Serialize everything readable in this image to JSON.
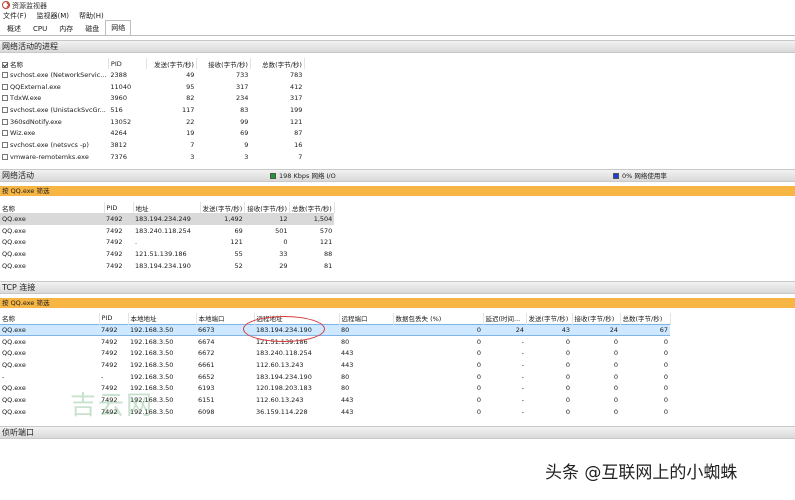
{
  "window": {
    "title": "资源监视器"
  },
  "menu": [
    "文件(F)",
    "监视器(M)",
    "帮助(H)"
  ],
  "tabs": [
    "概述",
    "CPU",
    "内存",
    "磁盘",
    "网络"
  ],
  "active_tab": "网络",
  "processes_section": {
    "title": "网络活动的进程",
    "headers": [
      "名称",
      "PID",
      "发送(字节/秒)",
      "接收(字节/秒)",
      "总数(字节/秒)"
    ],
    "rows": [
      [
        "svchost.exe (NetworkServic...",
        "2388",
        "49",
        "733",
        "783"
      ],
      [
        "QQExternal.exe",
        "11040",
        "95",
        "317",
        "412"
      ],
      [
        "TdxW.exe",
        "3960",
        "82",
        "234",
        "317"
      ],
      [
        "svchost.exe (UnistackSvcGr...",
        "516",
        "117",
        "83",
        "199"
      ],
      [
        "360sdNotify.exe",
        "13052",
        "22",
        "99",
        "121"
      ],
      [
        "Wiz.exe",
        "4264",
        "19",
        "69",
        "87"
      ],
      [
        "svchost.exe (netsvcs -p)",
        "3812",
        "7",
        "9",
        "16"
      ],
      [
        "vmware-remotemks.exe",
        "7376",
        "3",
        "3",
        "7"
      ]
    ]
  },
  "network_activity": {
    "title": "网络活动",
    "io_label": "198 Kbps 网络 I/O",
    "usage_label": "0% 网络使用率",
    "io_color": "#1a9c2e",
    "usage_color": "#1f3fd1",
    "filter": "按 QQ.exe 筛选",
    "headers": [
      "名称",
      "PID",
      "地址",
      "发送(字节/秒)",
      "接收(字节/秒)",
      "总数(字节/秒)"
    ],
    "rows": [
      [
        "QQ.exe",
        "7492",
        "183.194.234.249",
        "1,492",
        "12",
        "1,504"
      ],
      [
        "QQ.exe",
        "7492",
        "183.240.118.254",
        "69",
        "501",
        "570"
      ],
      [
        "QQ.exe",
        "7492",
        ".",
        "121",
        "0",
        "121"
      ],
      [
        "QQ.exe",
        "7492",
        "121.51.139.186",
        "55",
        "33",
        "88"
      ],
      [
        "QQ.exe",
        "7492",
        "183.194.234.190",
        "52",
        "29",
        "81"
      ]
    ]
  },
  "tcp_section": {
    "title": "TCP 连接",
    "filter": "按 QQ.exe 筛选",
    "headers": [
      "名称",
      "PID",
      "本地地址",
      "本地端口",
      "远程地址",
      "远程端口",
      "数据包丢失 (%)",
      "延迟(时间...",
      "发送(字节/秒)",
      "接收(字节/秒)",
      "总数(字节/秒)"
    ],
    "rows": [
      [
        "QQ.exe",
        "7492",
        "192.168.3.50",
        "6673",
        "183.194.234.190",
        "80",
        "0",
        "24",
        "43",
        "24",
        "67"
      ],
      [
        "QQ.exe",
        "7492",
        "192.168.3.50",
        "6674",
        "121.51.139.186",
        "80",
        "0",
        "-",
        "0",
        "0",
        "0"
      ],
      [
        "QQ.exe",
        "7492",
        "192.168.3.50",
        "6672",
        "183.240.118.254",
        "443",
        "0",
        "-",
        "0",
        "0",
        "0"
      ],
      [
        "QQ.exe",
        "7492",
        "192.168.3.50",
        "6661",
        "112.60.13.243",
        "443",
        "0",
        "-",
        "0",
        "0",
        "0"
      ],
      [
        "-",
        "-",
        "192.168.3.50",
        "6652",
        "183.194.234.190",
        "80",
        "0",
        "-",
        "0",
        "0",
        "0"
      ],
      [
        "QQ.exe",
        "7492",
        "192.168.3.50",
        "6193",
        "120.198.203.183",
        "80",
        "0",
        "-",
        "0",
        "0",
        "0"
      ],
      [
        "QQ.exe",
        "7492",
        "192.168.3.50",
        "6151",
        "112.60.13.243",
        "443",
        "0",
        "-",
        "0",
        "0",
        "0"
      ],
      [
        "QQ.exe",
        "7492",
        "192.168.3.50",
        "6098",
        "36.159.114.228",
        "443",
        "0",
        "-",
        "0",
        "0",
        "0"
      ]
    ]
  },
  "listening_section": {
    "title": "侦听端口"
  },
  "watermark_left": "吉云网",
  "watermark_right": "头条 @互联网上的小蜘蛛"
}
